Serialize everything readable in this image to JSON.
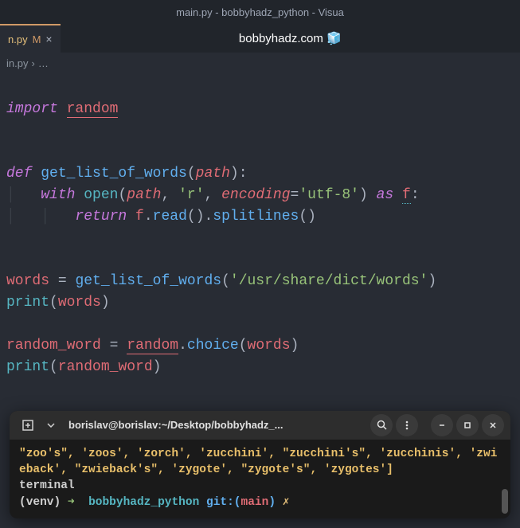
{
  "titleBar": "main.py - bobbyhadz_python - Visua",
  "tab": {
    "name": "n.py",
    "modified": "M",
    "close": "×"
  },
  "watermark": "bobbyhadz.com 🧊",
  "breadcrumb": {
    "file": "in.py",
    "sep": "›",
    "more": "…"
  },
  "code": {
    "l1_import": "import",
    "l1_random": "random",
    "l3_def": "def",
    "l3_fn": "get_list_of_words",
    "l3_param": "path",
    "l4_with": "with",
    "l4_open": "open",
    "l4_path": "path",
    "l4_r": "'r'",
    "l4_encoding": "encoding",
    "l4_utf": "'utf-8'",
    "l4_as": "as",
    "l4_f": "f",
    "l5_return": "return",
    "l5_f": "f",
    "l5_read": "read",
    "l5_split": "splitlines",
    "l7_words": "words",
    "l7_fn": "get_list_of_words",
    "l7_path": "'/usr/share/dict/words'",
    "l8_print": "print",
    "l8_words": "words",
    "l10_rw": "random_word",
    "l10_random": "random",
    "l10_choice": "choice",
    "l10_words": "words",
    "l11_print": "print",
    "l11_rw": "random_word"
  },
  "terminal": {
    "title": "borislav@borislav:~/Desktop/bobbyhadz_...",
    "output_items": "\"zoo's\", 'zoos', 'zorch', 'zucchini', \"zucchini's\", 'zucchinis', 'zwieback', \"zwieback's\", 'zygote', \"zygote's\", 'zygotes']",
    "word": "terminal",
    "prompt_venv": "(venv)",
    "prompt_arrow": "➜",
    "prompt_dir": "bobbyhadz_python",
    "prompt_git": "git:(",
    "prompt_branch": "main",
    "prompt_gitclose": ")",
    "prompt_dirty": "✗"
  }
}
